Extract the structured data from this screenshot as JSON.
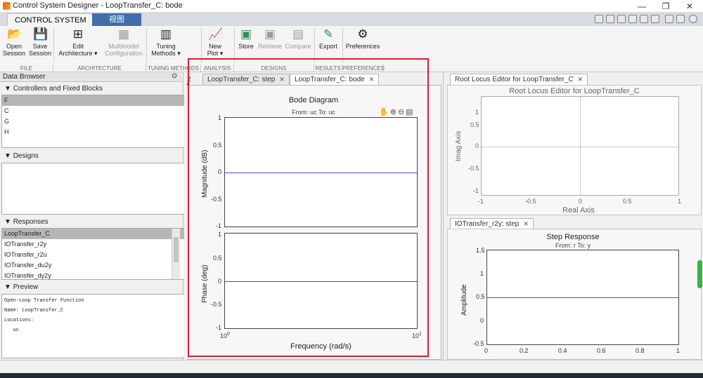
{
  "window": {
    "title": "Control System Designer - LoopTransfer_C: bode"
  },
  "tabs": {
    "control_system": "CONTROL SYSTEM",
    "view": "视图"
  },
  "ribbon": {
    "open_session": "Open Session",
    "save_session": "Save Session",
    "edit_architecture": "Edit Architecture ▾",
    "multimodel_configuration": "Multimodel Configuration",
    "tuning_methods": "Tuning Methods ▾",
    "new_plot": "New Plot ▾",
    "store": "Store",
    "retrieve": "Retrieve",
    "compare": "Compare",
    "export": "Export",
    "preferences": "Preferences",
    "sections": [
      "FILE",
      "ARCHITECTURE",
      "TUNING METHODS",
      "ANALYSIS",
      "DESIGNS",
      "RESULTS",
      "PREFERENCES"
    ]
  },
  "data_browser": {
    "title": "Data Browser",
    "controllers_title": "Controllers and Fixed Blocks",
    "controllers": [
      "F",
      "C",
      "G",
      "H"
    ],
    "designs_title": "Designs",
    "responses_title": "Responses",
    "responses": [
      "LoopTransfer_C",
      "IOTransfer_r2y",
      "IOTransfer_r2u",
      "IOTransfer_du2y",
      "IOTransfer_dy2y"
    ],
    "preview_title": "Preview",
    "preview_lines": [
      "Open-Loop Transfer Function",
      "Name: LoopTransfer_C",
      "Locations:",
      "   uc"
    ]
  },
  "doc_tabs": {
    "step": "LoopTransfer_C: step",
    "bode": "LoopTransfer_C: bode",
    "overflow": "2"
  },
  "bode": {
    "title": "Bode Diagram",
    "subtitle": "From: uc  To: uc",
    "mag_ylabel": "Magnitude (dB)",
    "phase_ylabel": "Phase (deg)",
    "xlabel": "Frequency  (rad/s)",
    "y_ticks": [
      "1",
      "0.5",
      "0",
      "-0.5",
      "-1"
    ],
    "x_tick_left": "10",
    "x_tick_left_exp": "0",
    "x_tick_right": "10",
    "x_tick_right_exp": "1"
  },
  "root_locus": {
    "tab": "Root Locus Editor for LoopTransfer_C",
    "title": "Root Locus Editor for LoopTransfer_C",
    "ylabel": "Imag Axis",
    "xlabel": "Real Axis",
    "y_ticks": [
      "1",
      "0.5",
      "0",
      "-0.5",
      "-1"
    ],
    "x_ticks": [
      "-1",
      "-0.5",
      "0",
      "0.5",
      "1"
    ]
  },
  "step_response": {
    "tab": "IOTransfer_r2y: step",
    "title": "Step Response",
    "subtitle": "From: r  To: y",
    "ylabel": "Amplitude",
    "y_ticks": [
      "1.5",
      "1",
      "0.5",
      "0",
      "-0.5"
    ],
    "x_ticks": [
      "0",
      "0.2",
      "0.4",
      "0.6",
      "0.8",
      "1"
    ]
  },
  "colors": {
    "highlight": "#e1192f",
    "trace": "#4a4ad0",
    "tab_blue": "#3f6ea8"
  }
}
